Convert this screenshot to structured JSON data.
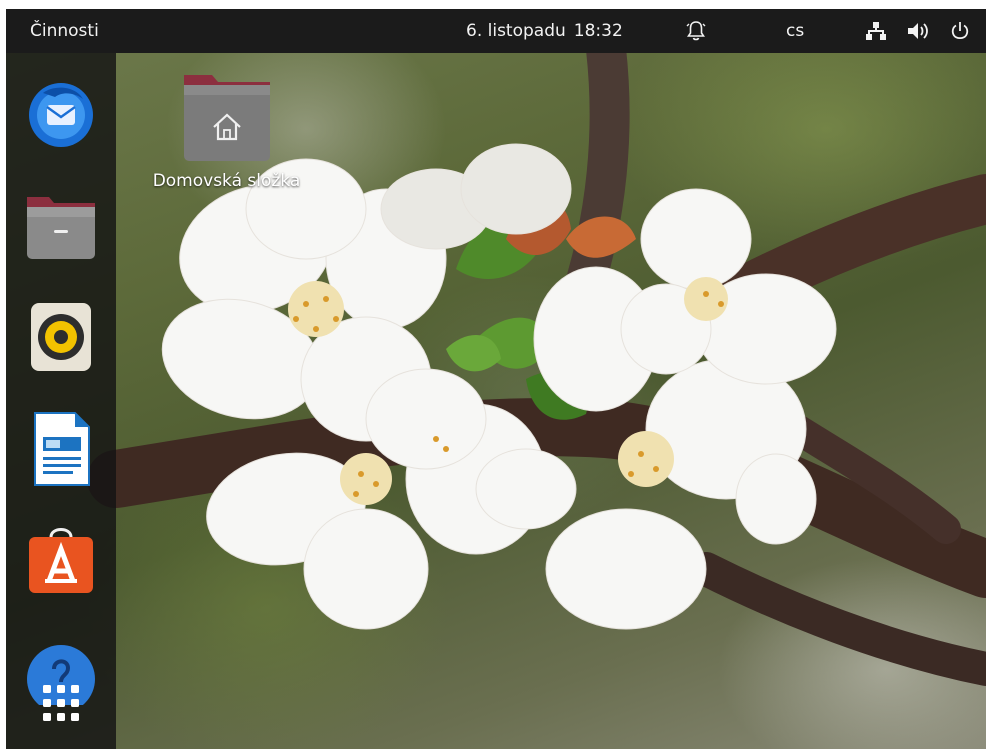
{
  "top_bar": {
    "activities": "Činnosti",
    "date": "6. listopadu",
    "time": "18:32",
    "alarm_icon": "bell-icon",
    "language": "cs",
    "network_icon": "network-icon",
    "volume_icon": "speaker-icon",
    "power_icon": "power-icon"
  },
  "dock": {
    "apps": [
      {
        "name": "thunderbird",
        "icon": "thunderbird-mail-icon"
      },
      {
        "name": "files",
        "icon": "files-folder-icon"
      },
      {
        "name": "rhythmbox",
        "icon": "rhythmbox-speaker-icon"
      },
      {
        "name": "writer",
        "icon": "libreoffice-writer-icon"
      },
      {
        "name": "software",
        "icon": "software-store-icon"
      },
      {
        "name": "help",
        "icon": "help-icon"
      },
      {
        "name": "show-applications",
        "icon": "app-grid-icon"
      }
    ]
  },
  "desktop": {
    "icons": [
      {
        "label": "Domovská složka",
        "icon": "home-folder-icon"
      }
    ]
  },
  "colors": {
    "topbar_bg": "#1b1b1b",
    "dock_bg": "#141414",
    "folder_top": "#8c2f3f",
    "folder_body": "#7b7b7b",
    "software_orange": "#e95420",
    "thunderbird_blue": "#1a6fd6"
  }
}
